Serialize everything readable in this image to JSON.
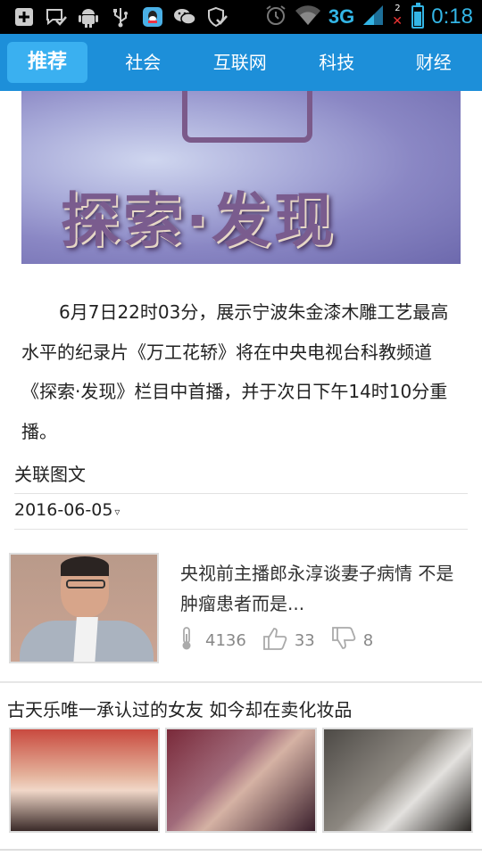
{
  "status_bar": {
    "network": "3G",
    "time": "0:18",
    "battery_level": 0.75,
    "notification_count": "2",
    "icons": [
      "add-icon",
      "message-check-icon",
      "android-icon",
      "usb-icon",
      "qq-icon",
      "wechat-icon",
      "shield-check-icon",
      "alarm-icon",
      "wifi-icon",
      "signal-icon",
      "battery-icon"
    ],
    "accent": "#33b5e5"
  },
  "tabs": {
    "items": [
      {
        "label": "推荐",
        "active": true
      },
      {
        "label": "社会"
      },
      {
        "label": "互联网"
      },
      {
        "label": "科技"
      },
      {
        "label": "财经"
      }
    ],
    "bar_color": "#1d8fd9",
    "active_color": "#3ab0f0"
  },
  "hero": {
    "text": "探索·发现"
  },
  "article": {
    "body": "6月7日22时03分，展示宁波朱金漆木雕工艺最高水平的纪录片《万工花轿》将在中央电视台科教频道《探索·发现》栏目中首播，并于次日下午14时10分重播。"
  },
  "related": {
    "title": "关联图文",
    "date": "2016-06-05",
    "dropdown_symbol": "▿"
  },
  "news_item": {
    "title": "央视前主播郎永淳谈妻子病情 不是肿瘤患者而是...",
    "views": "4136",
    "likes": "33",
    "dislikes": "8"
  },
  "gallery": {
    "title": "古天乐唯一承认过的女友 如今却在卖化妆品"
  }
}
